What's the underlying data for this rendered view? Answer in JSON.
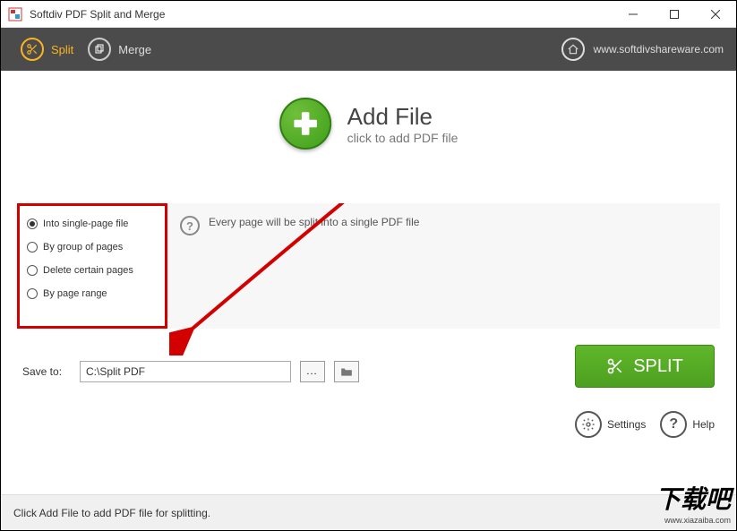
{
  "window": {
    "title": "Softdiv PDF Split and Merge"
  },
  "toolbar": {
    "split_label": "Split",
    "merge_label": "Merge",
    "website_label": "www.softdivshareware.com"
  },
  "addfile": {
    "title": "Add File",
    "subtitle": "click to add PDF file"
  },
  "options": {
    "into_single": "Into single-page file",
    "by_group": "By group of pages",
    "delete_pages": "Delete certain pages",
    "by_range": "By page range",
    "description": "Every page will be split into a single PDF file"
  },
  "save": {
    "label": "Save to:",
    "path": "C:\\Split PDF",
    "browse": "...",
    "split_button": "SPLIT"
  },
  "footer": {
    "settings": "Settings",
    "help": "Help"
  },
  "status": {
    "text": "Click Add File to add PDF file for splitting."
  },
  "watermark": {
    "big": "下载吧",
    "small": "www.xiazaiba.com"
  }
}
